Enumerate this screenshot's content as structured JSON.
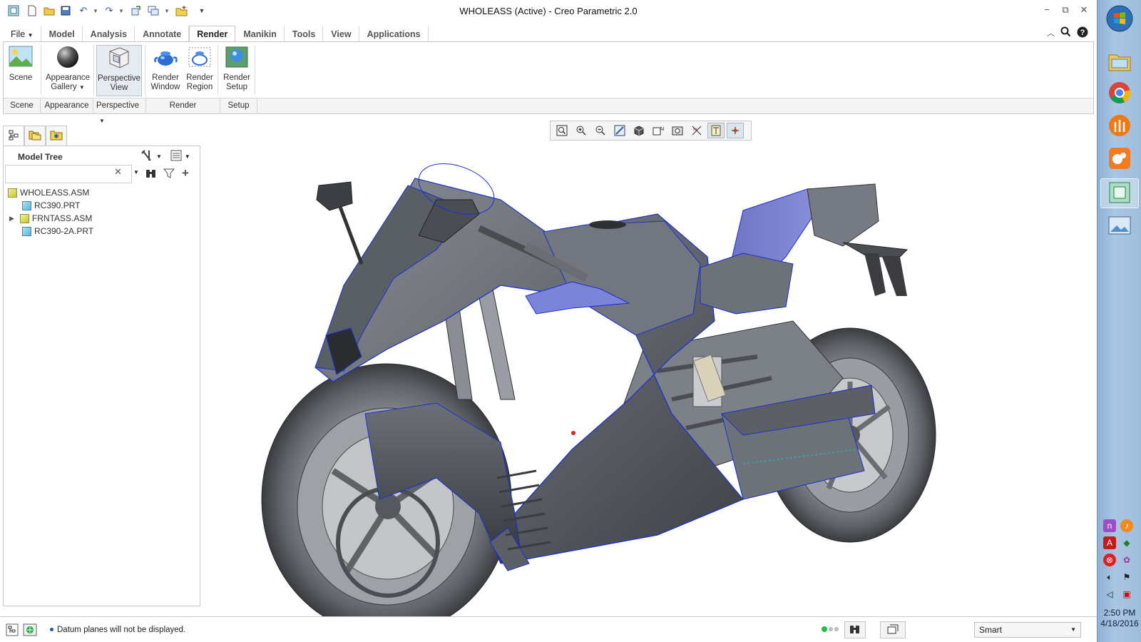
{
  "window": {
    "title": "WHOLEASS (Active) - Creo Parametric 2.0",
    "minimize": "−",
    "restore": "⧉",
    "close": "✕"
  },
  "ribbon": {
    "file_label": "File",
    "tabs": [
      "Model",
      "Analysis",
      "Annotate",
      "Render",
      "Manikin",
      "Tools",
      "View",
      "Applications"
    ],
    "active_tab": "Render",
    "buttons": {
      "scene": "Scene",
      "appearance_line1": "Appearance",
      "appearance_line2": "Gallery",
      "perspective_line1": "Perspective",
      "perspective_line2": "View",
      "render_window_line1": "Render",
      "render_window_line2": "Window",
      "render_region_line1": "Render",
      "render_region_line2": "Region",
      "render_setup_line1": "Render",
      "render_setup_line2": "Setup"
    },
    "groups": {
      "scene": "Scene",
      "appearance": "Appearance",
      "perspective": "Perspective",
      "render": "Render",
      "setup": "Setup"
    }
  },
  "model_tree": {
    "title": "Model Tree",
    "search_value": "",
    "items": [
      {
        "label": "WHOLEASS.ASM"
      },
      {
        "label": "RC390.PRT"
      },
      {
        "label": "FRNTASS.ASM"
      },
      {
        "label": "RC390-2A.PRT"
      }
    ]
  },
  "status": {
    "message": "Datum planes will not be displayed.",
    "filter_value": "Smart"
  },
  "taskbar": {
    "time": "2:50 PM",
    "date": "4/18/2016"
  },
  "colors": {
    "accent_blue": "#1a2fd6",
    "taskbar": "#a9c6e2",
    "model_body": "#5d6169"
  }
}
